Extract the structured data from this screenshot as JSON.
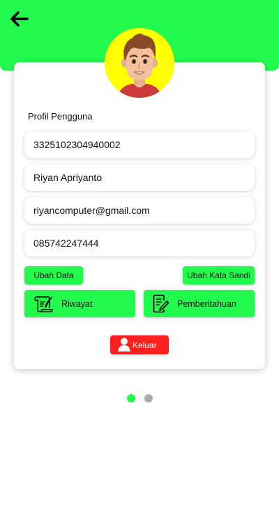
{
  "header": {
    "back_icon": "arrow-left-icon",
    "color": "#22fb4e"
  },
  "profile": {
    "avatar_icon": "user-avatar-cartoon",
    "title": "Profil Pengguna",
    "fields": {
      "id_number": "3325102304940002",
      "name": "Riyan Apriyanto",
      "email": "riyancomputer@gmail.com",
      "phone": "085742247444"
    }
  },
  "actions": {
    "edit_data": "Ubah Data",
    "change_password": "Ubah Kata Sandi",
    "history": {
      "label": "Riwayat",
      "icon": "scroll-quill-icon"
    },
    "notifications": {
      "label": "Pemberitahuan",
      "icon": "document-edit-icon"
    },
    "logout": {
      "label": "Keluar",
      "icon": "user-icon",
      "color": "#ff1f1f"
    }
  },
  "pagination": {
    "pages": 2,
    "active": 1,
    "active_color": "#22fb4e",
    "inactive_color": "#aaaaaa"
  }
}
